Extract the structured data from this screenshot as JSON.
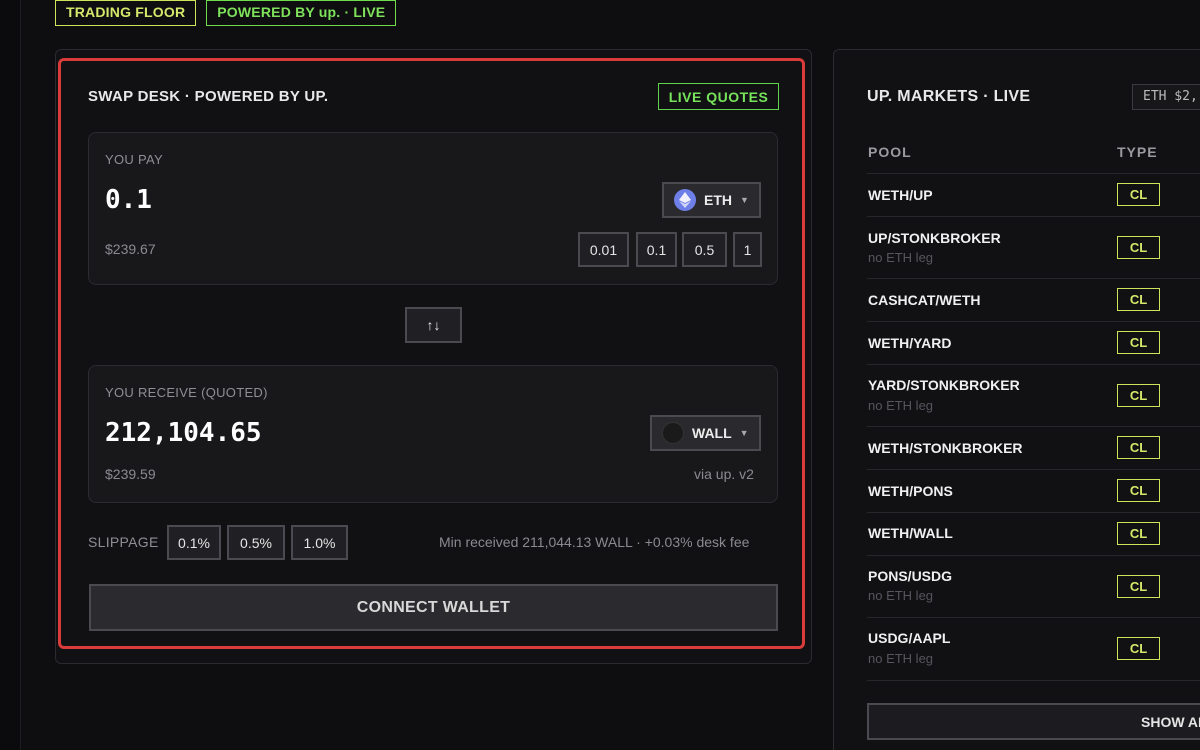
{
  "top_tags": {
    "trading_floor": "TRADING FLOOR",
    "powered": "POWERED BY up. · LIVE"
  },
  "swap": {
    "title": "SWAP DESK · POWERED BY UP.",
    "live_quotes": "LIVE QUOTES",
    "pay": {
      "label": "YOU PAY",
      "amount": "0.1",
      "usd": "$239.67",
      "token": "ETH",
      "quick_amounts": [
        "0.01",
        "0.1",
        "0.5",
        "1"
      ]
    },
    "flip_label": "↑↓",
    "receive": {
      "label": "YOU RECEIVE (QUOTED)",
      "amount": "212,104.65",
      "usd": "$239.59",
      "token": "WALL",
      "route": "via up. v2"
    },
    "slippage": {
      "label": "SLIPPAGE",
      "options": [
        "0.1%",
        "0.5%",
        "1.0%"
      ]
    },
    "min_received": "Min received 211,044.13 WALL · +0.03% desk fee",
    "connect_label": "CONNECT WALLET"
  },
  "markets": {
    "title": "UP. MARKETS · LIVE",
    "eth_ticker": "ETH $2,",
    "columns": {
      "pool": "POOL",
      "type": "TYPE"
    },
    "rows": [
      {
        "pool": "WETH/UP",
        "sub": "",
        "type": "CL"
      },
      {
        "pool": "UP/STONKBROKER",
        "sub": "no ETH leg",
        "type": "CL"
      },
      {
        "pool": "CASHCAT/WETH",
        "sub": "",
        "type": "CL"
      },
      {
        "pool": "WETH/YARD",
        "sub": "",
        "type": "CL"
      },
      {
        "pool": "YARD/STONKBROKER",
        "sub": "no ETH leg",
        "type": "CL"
      },
      {
        "pool": "WETH/STONKBROKER",
        "sub": "",
        "type": "CL"
      },
      {
        "pool": "WETH/PONS",
        "sub": "",
        "type": "CL"
      },
      {
        "pool": "WETH/WALL",
        "sub": "",
        "type": "CL"
      },
      {
        "pool": "PONS/USDG",
        "sub": "no ETH leg",
        "type": "CL"
      },
      {
        "pool": "USDG/AAPL",
        "sub": "no ETH leg",
        "type": "CL"
      }
    ],
    "show_all": "SHOW AL"
  },
  "icons": {
    "eth": "ethereum-icon",
    "wall": "wall-token-icon",
    "caret": "chevron-down-icon"
  },
  "colors": {
    "accent_yellow": "#cfe45b",
    "accent_green": "#6fdc4e",
    "highlight_red": "#d93a3a"
  }
}
